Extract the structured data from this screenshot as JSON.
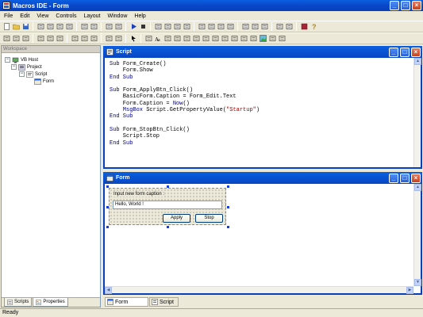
{
  "app": {
    "title": "Macros IDE - Form",
    "icon": "macros-ide-icon"
  },
  "menu": [
    "File",
    "Edit",
    "View",
    "Controls",
    "Layout",
    "Window",
    "Help"
  ],
  "toolbar1": [
    {
      "icon": "new-icon"
    },
    {
      "icon": "open-icon"
    },
    {
      "icon": "save-icon"
    },
    {
      "sep": true
    },
    {
      "icon": "cut-icon"
    },
    {
      "icon": "copy-icon"
    },
    {
      "icon": "paste-icon"
    },
    {
      "icon": "delete-icon"
    },
    {
      "sep": true
    },
    {
      "icon": "undo-icon"
    },
    {
      "icon": "redo-icon"
    },
    {
      "sep": true
    },
    {
      "icon": "indent-icon"
    },
    {
      "icon": "outdent-icon"
    },
    {
      "sep": true
    },
    {
      "icon": "run-icon"
    },
    {
      "icon": "stop-icon"
    },
    {
      "sep": true
    },
    {
      "icon": "find-icon"
    },
    {
      "icon": "find-next-icon"
    },
    {
      "icon": "replace-icon"
    },
    {
      "icon": "goto-icon"
    },
    {
      "sep": true
    },
    {
      "icon": "bring-front-icon"
    },
    {
      "icon": "send-back-icon"
    },
    {
      "icon": "group-icon"
    },
    {
      "icon": "ungroup-icon"
    },
    {
      "sep": true
    },
    {
      "icon": "window-tile-icon"
    },
    {
      "icon": "window-horizontal-icon"
    },
    {
      "icon": "window-vertical-icon"
    },
    {
      "sep": true
    },
    {
      "icon": "new-window-icon"
    },
    {
      "icon": "clone-window-icon"
    },
    {
      "sep": true
    },
    {
      "icon": "book-icon"
    },
    {
      "icon": "help-icon"
    }
  ],
  "toolbar2": [
    {
      "icon": "align-left-icon"
    },
    {
      "icon": "align-center-icon"
    },
    {
      "icon": "align-right-icon"
    },
    {
      "sep": true
    },
    {
      "icon": "align-top-icon"
    },
    {
      "icon": "align-middle-icon"
    },
    {
      "icon": "align-bottom-icon"
    },
    {
      "sep": true
    },
    {
      "icon": "same-width-icon"
    },
    {
      "icon": "same-height-icon"
    },
    {
      "icon": "same-size-icon"
    },
    {
      "sep": true
    },
    {
      "icon": "grid-icon"
    },
    {
      "icon": "tab-order-icon"
    },
    {
      "sep": true
    },
    {
      "icon": "pointer-icon"
    },
    {
      "sep": true
    },
    {
      "icon": "frame-icon"
    },
    {
      "icon": "label-icon"
    },
    {
      "icon": "textbox-icon"
    },
    {
      "icon": "button-icon"
    },
    {
      "icon": "checkbox-icon"
    },
    {
      "icon": "radio-icon"
    },
    {
      "icon": "listbox-icon"
    },
    {
      "icon": "combobox-icon"
    },
    {
      "icon": "hscroll-icon"
    },
    {
      "icon": "vscroll-icon"
    },
    {
      "icon": "tree-icon"
    },
    {
      "icon": "list-view-icon"
    },
    {
      "icon": "image-icon"
    },
    {
      "icon": "progress-icon"
    },
    {
      "icon": "tools-icon"
    }
  ],
  "workspace": {
    "title": "Workspace",
    "tree": [
      {
        "label": "VB Host",
        "level": 0,
        "expander": "−",
        "icon": "host-icon"
      },
      {
        "label": "Project",
        "level": 1,
        "expander": "−",
        "icon": "project-icon"
      },
      {
        "label": "Script",
        "level": 2,
        "expander": "−",
        "icon": "script-icon"
      },
      {
        "label": "Form",
        "level": 3,
        "expander": "",
        "icon": "form-icon"
      }
    ],
    "tabs": [
      {
        "label": "Scripts",
        "icon": "scripts-tab-icon",
        "active": false
      },
      {
        "label": "Properties",
        "icon": "properties-tab-icon",
        "active": true
      }
    ]
  },
  "script_window": {
    "title": "Script",
    "code": [
      [
        [
          "Sub ",
          "kw"
        ],
        [
          "Form_Create()",
          ""
        ]
      ],
      [
        [
          "    Form.Show",
          ""
        ]
      ],
      [
        [
          "End Sub",
          "kw"
        ]
      ],
      [
        [
          "",
          ""
        ]
      ],
      [
        [
          "Sub ",
          "kw"
        ],
        [
          "Form_ApplyBtn_Click()",
          ""
        ]
      ],
      [
        [
          "    BasicForm.Caption = Form_Edit.Text",
          ""
        ]
      ],
      [
        [
          "    Form.Caption = ",
          ""
        ],
        [
          "Now",
          "kw"
        ],
        [
          "()",
          ""
        ]
      ],
      [
        [
          "    MsgBox ",
          "kw"
        ],
        [
          "Script.GetPropertyValue(",
          ""
        ],
        [
          "\"Startup\"",
          "str"
        ],
        [
          ")",
          ""
        ]
      ],
      [
        [
          "End Sub",
          "kw"
        ]
      ],
      [
        [
          "",
          ""
        ]
      ],
      [
        [
          "Sub ",
          "kw"
        ],
        [
          "Form_StopBtn_Click()",
          ""
        ]
      ],
      [
        [
          "    Script.Stop",
          ""
        ]
      ],
      [
        [
          "End Sub",
          "kw"
        ]
      ]
    ]
  },
  "form_window": {
    "title": "Form",
    "design": {
      "label": "Input new form caption :",
      "edit_value": "Hello, World !",
      "apply_label": "Apply",
      "stop_label": "Stop"
    }
  },
  "doc_tabs": [
    {
      "label": "Form",
      "icon": "form-doc-icon",
      "active": true
    },
    {
      "label": "Script",
      "icon": "script-doc-icon",
      "active": false
    }
  ],
  "status": "Ready"
}
